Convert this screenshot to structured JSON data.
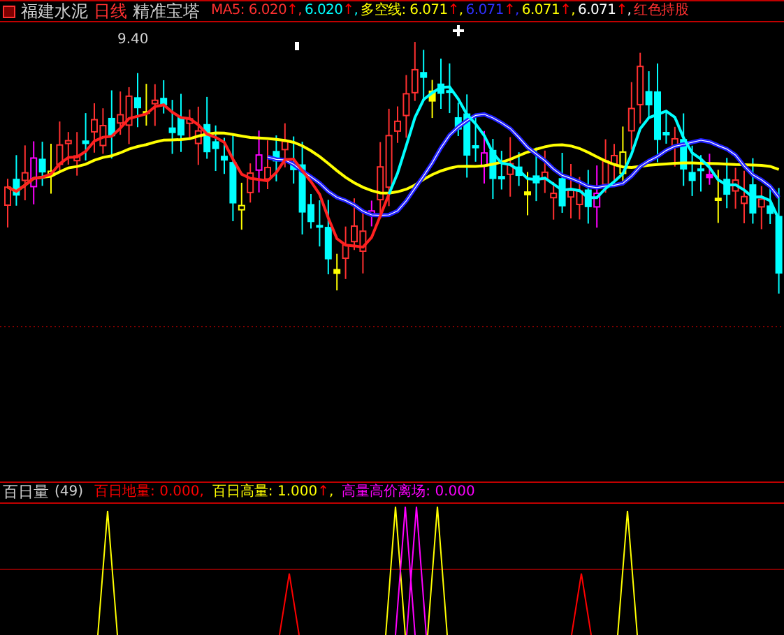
{
  "header": {
    "stock": "福建水泥",
    "period": "日线",
    "indicator": "精准宝塔"
  },
  "main_legend": [
    {
      "label": "MA5: ",
      "value": "6.020",
      "arrow": "↑",
      "sep": ","
    },
    {
      "value": "6.020",
      "arrow": "↑",
      "sep": ","
    },
    {
      "label": "多空线: ",
      "value": "6.071",
      "arrow": "↑",
      "sep": ","
    },
    {
      "value": "6.071",
      "arrow": "↑",
      "sep": ","
    },
    {
      "value": "6.071",
      "arrow": "↑",
      "sep": ","
    },
    {
      "value": "6.071",
      "arrow": "↑",
      "sep": ","
    },
    {
      "label": "红色持股"
    }
  ],
  "high_label": "9.40",
  "lower": {
    "title": "百日量",
    "param": "(49)",
    "legend": [
      {
        "label": "百日地量: ",
        "value": "0.000",
        "sep": ","
      },
      {
        "label": "百日高量: ",
        "value": "1.000",
        "arrow": "↑",
        "sep": ","
      },
      {
        "label": "高量高价离场: ",
        "value": "0.000"
      }
    ]
  }
}
